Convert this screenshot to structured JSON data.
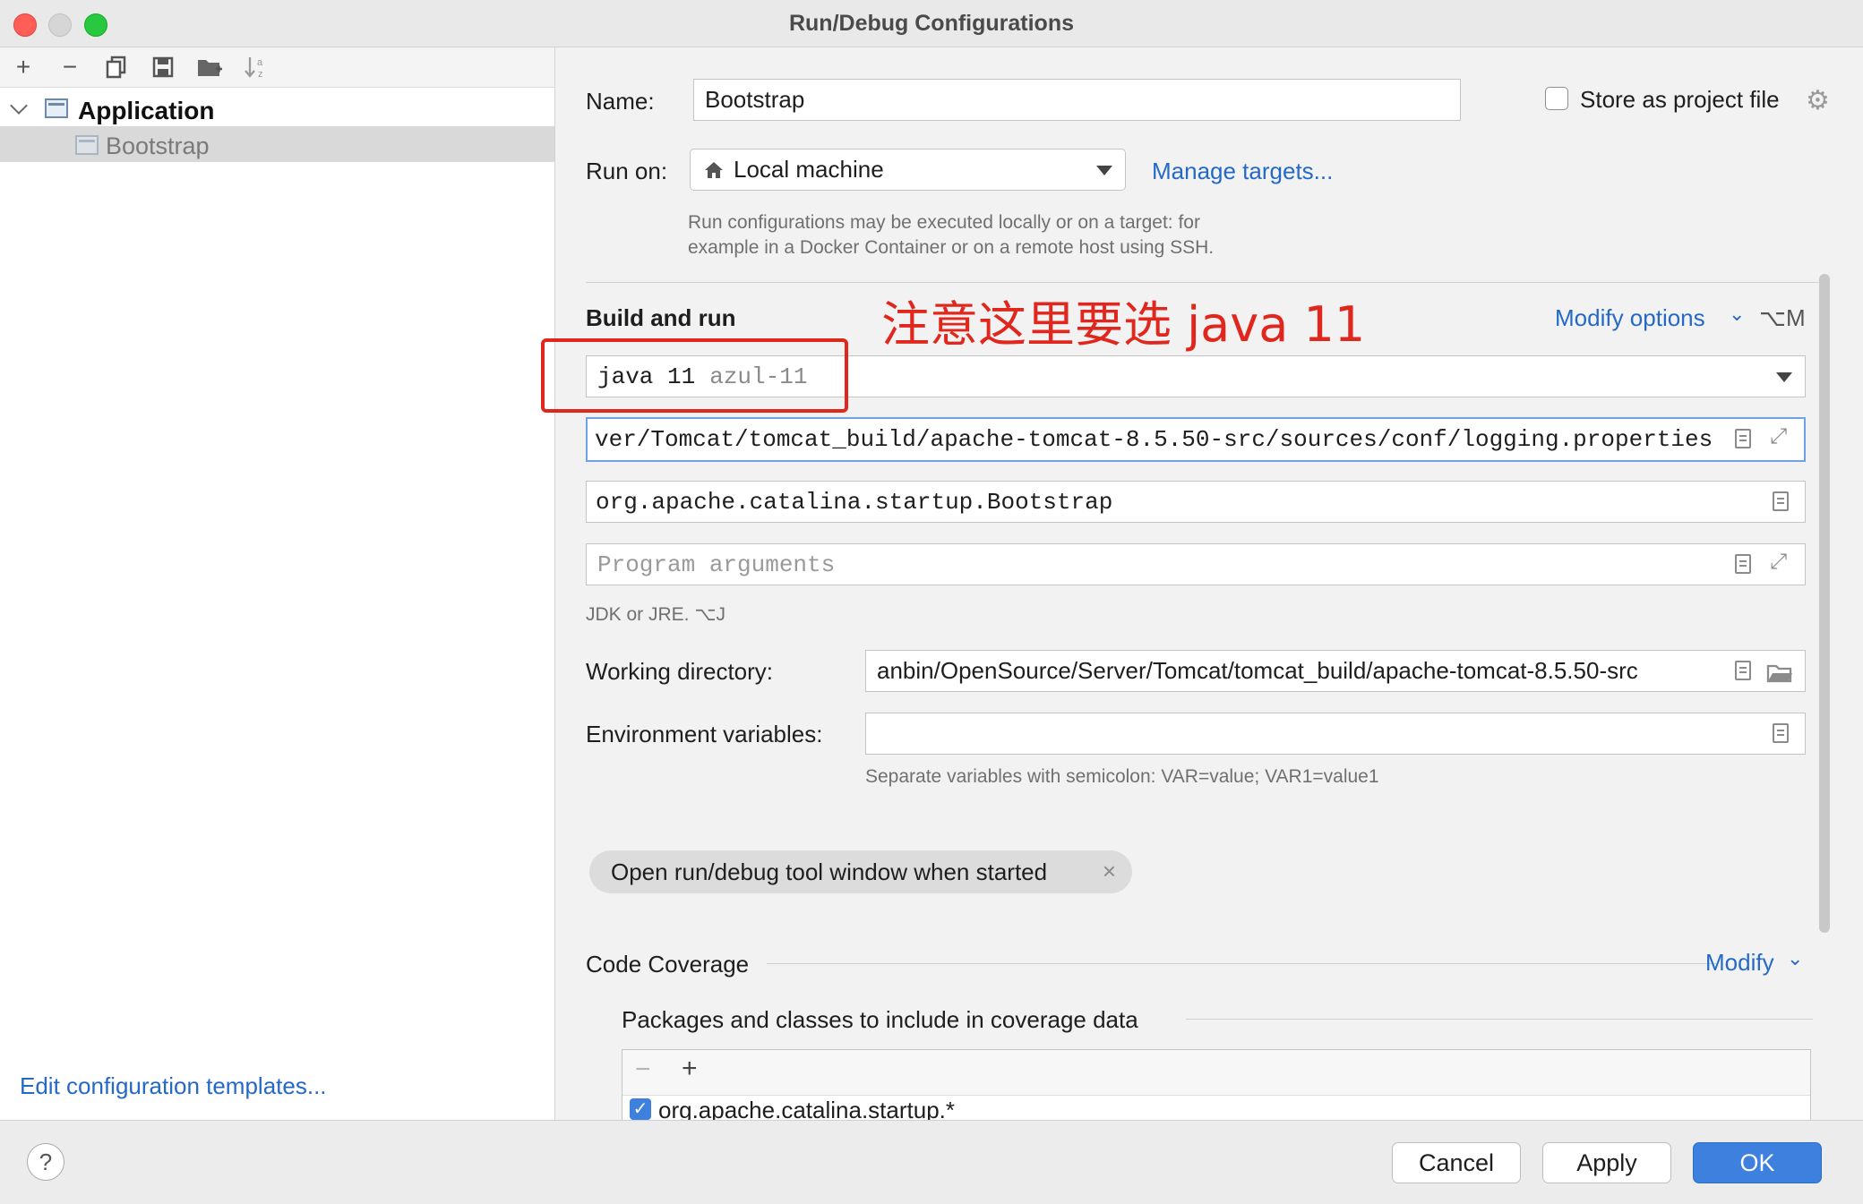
{
  "window": {
    "title": "Run/Debug Configurations"
  },
  "left": {
    "toolbar_icons": [
      "add-icon",
      "remove-icon",
      "copy-icon",
      "save-icon",
      "new-folder-icon",
      "sort-icon"
    ],
    "tree": [
      {
        "label": "Application",
        "expanded": true
      },
      {
        "label": "Bootstrap",
        "selected": true
      }
    ],
    "edit_templates": "Edit configuration templates..."
  },
  "form": {
    "name_label": "Name:",
    "name_value": "Bootstrap",
    "store_label": "Store as project file",
    "run_on_label": "Run on:",
    "run_on_value": "Local machine",
    "manage_targets": "Manage targets...",
    "run_hint_1": "Run configurations may be executed locally or on a target: for",
    "run_hint_2": "example in a Docker Container or on a remote host using SSH.",
    "build_run_title": "Build and run",
    "modify_options": "Modify options",
    "modify_shortcut": "⌥M",
    "annotation": "注意这里要选 java 11",
    "jdk_value": "java 11",
    "jdk_hint": "azul-11",
    "vm_options": "ver/Tomcat/tomcat_build/apache-tomcat-8.5.50-src/sources/conf/logging.properties",
    "main_class": "org.apache.catalina.startup.Bootstrap",
    "program_args_placeholder": "Program arguments",
    "jdk_hint_text": "JDK or JRE. ⌥J",
    "working_dir_label": "Working directory:",
    "working_dir_value": "anbin/OpenSource/Server/Tomcat/tomcat_build/apache-tomcat-8.5.50-src",
    "env_label": "Environment variables:",
    "env_value": "",
    "env_hint": "Separate variables with semicolon: VAR=value; VAR1=value1",
    "chip_label": "Open run/debug tool window when started",
    "coverage_title": "Code Coverage",
    "coverage_modify": "Modify",
    "coverage_packages": "Packages and classes to include in coverage data",
    "coverage_item": "org.apache.catalina.startup.*"
  },
  "buttons": {
    "cancel": "Cancel",
    "apply": "Apply",
    "ok": "OK",
    "help": "?"
  },
  "colors": {
    "accent": "#3d80dd",
    "link": "#2569c6",
    "annotation": "#e0271d"
  }
}
